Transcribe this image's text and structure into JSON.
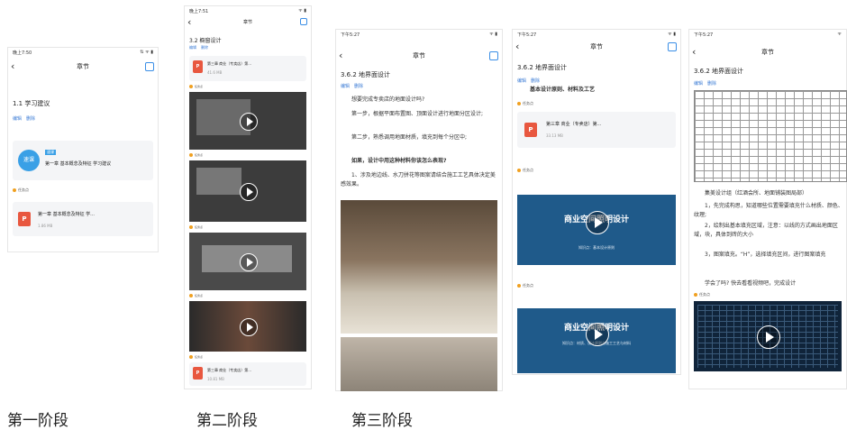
{
  "captions": [
    "第一阶段",
    "第二阶段",
    "第三阶段"
  ],
  "common": {
    "edit": "编辑",
    "delete": "删除",
    "nav_title": "章节",
    "task_point": "任务点",
    "back_icon": "chevron-left-icon"
  },
  "s1": {
    "time": "晚上7:50",
    "status": "⇅ ᯤ ▮",
    "section": "1.1 学习建议",
    "course_tag": "速课",
    "course_badge": "速课",
    "course_title": "第一章 基本概念及特征 学习建议",
    "file_name": "第一章 基本概念及特征 学...",
    "file_size": "1.86 MB",
    "ppt_glyph": "P"
  },
  "s2": {
    "time": "晚上7:51",
    "status": "ᯤ ▮",
    "section": "3.2 橱窗设计",
    "file1_name": "第三章 商业（专卖店）第...",
    "file1_size": "41.6 MB",
    "file2_name": "第三章 商业（专卖店）第...",
    "file2_size": "10.81 MB"
  },
  "s3": {
    "time": "下午5:27",
    "status": "ᯤ ▮",
    "section": "3.6.2 地界面设计",
    "p1": "想要完成专卖店的地面设计吗?",
    "p2": "第一步，根据平面布置图、顶面设计进行地面分区设计;",
    "p3": "第二步，熟悉调用地面材质，填充到每个分区中;",
    "p4": "如果，设计中用这种材料你该怎么表现?",
    "p5": "1、涉及地边线、水刀拼花等图案请结合施工工艺具体决定美感效果。"
  },
  "s4": {
    "time": "下午5:27",
    "status": "ᯤ ▮",
    "section": "3.6.2 地界面设计",
    "subtitle": "基本设计原则、材料及工艺",
    "file_name": "第三章 商业（专卖店）第...",
    "file_size": "33.13 MB",
    "video_title": "商业空间照明设计",
    "video_sub1": "知识点：基本设计原则",
    "video_sub2": "知识点：材质、设计原则与施工工艺与材料"
  },
  "s5": {
    "time": "下午5:27",
    "status": "ᯤ",
    "section": "3.6.2 地界面设计",
    "p1": "集美设计组（红酒会所、地面铺装图局部）",
    "p2": "1，先完成构思，知道哪些位置需要填充什么材质、颜色、纹理;",
    "p3": "2，绘制出基本填充区域，注意：以线的方式画出地面区域，块，具体到砖的大小",
    "p4": "3，图案填充。“H”，选择填充区间，进行图案填充",
    "p5": "学会了吗? 快去看看视频吧，完成设计"
  }
}
